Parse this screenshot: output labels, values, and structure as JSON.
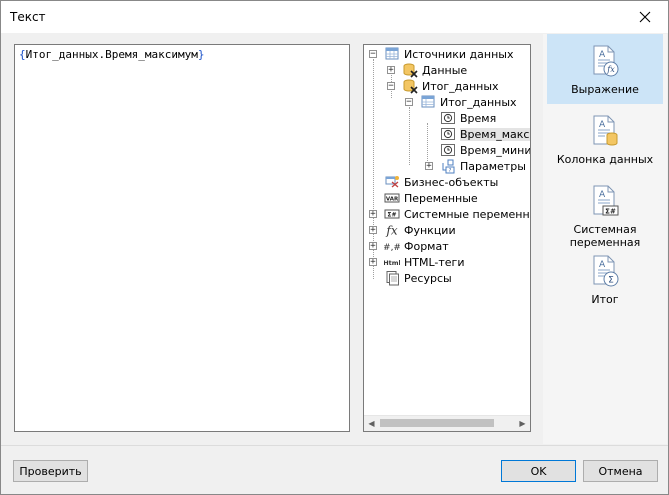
{
  "window": {
    "title": "Текст"
  },
  "editor": {
    "open_brace": "{",
    "expression": "Итог_данных.Время_максимум",
    "close_brace": "}"
  },
  "tree": {
    "items": [
      {
        "label": "Источники данных",
        "icon": "datasources-icon",
        "expander": "−"
      },
      {
        "label": "Данные",
        "icon": "database-error-icon",
        "expander": "+"
      },
      {
        "label": "Итог_данных",
        "icon": "database-error-icon",
        "expander": "−"
      },
      {
        "label": "Итог_данных",
        "icon": "table-icon",
        "expander": "−"
      },
      {
        "label": "Время",
        "icon": "clock-field-icon"
      },
      {
        "label": "Время_макси",
        "icon": "clock-field-icon"
      },
      {
        "label": "Время_миним",
        "icon": "clock-field-icon"
      },
      {
        "label": "Параметры",
        "icon": "parameters-icon",
        "expander": "+"
      },
      {
        "label": "Бизнес-объекты",
        "icon": "business-objects-icon"
      },
      {
        "label": "Переменные",
        "icon": "variable-icon"
      },
      {
        "label": "Системные переменные",
        "icon": "system-variable-icon",
        "expander": "+"
      },
      {
        "label": "Функции",
        "icon": "function-icon",
        "expander": "+"
      },
      {
        "label": "Формат",
        "icon": "format-icon",
        "expander": "+"
      },
      {
        "label": "HTML-теги",
        "icon": "html-tag-icon",
        "expander": "+"
      },
      {
        "label": "Ресурсы",
        "icon": "resources-icon"
      }
    ],
    "selected_index": 5
  },
  "side_panel": {
    "buttons": [
      {
        "label": "Выражение",
        "icon": "expression-icon",
        "active": true
      },
      {
        "label": "Колонка данных",
        "icon": "data-column-icon",
        "active": false
      },
      {
        "label_line1": "Системная",
        "label_line2": "переменная",
        "icon": "system-variable-icon",
        "active": false
      },
      {
        "label": "Итог",
        "icon": "total-icon",
        "active": false
      }
    ]
  },
  "footer": {
    "check_label": "Проверить",
    "ok_label": "OK",
    "cancel_label": "Отмена"
  },
  "colors": {
    "accent": "#0078d7",
    "active_tab": "#cce4f7",
    "brace": "#1a50c8"
  }
}
